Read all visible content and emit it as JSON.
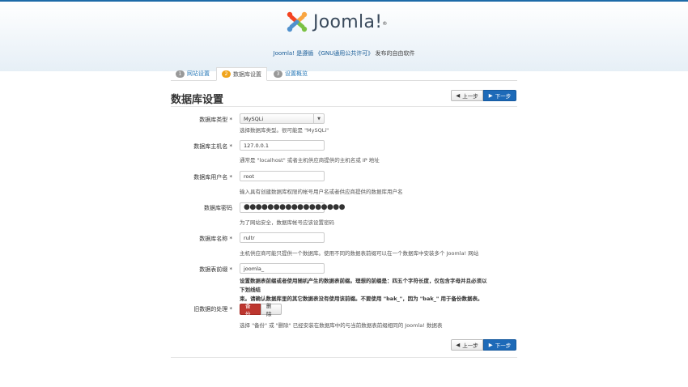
{
  "header": {
    "logo_text": "Joomla!",
    "tagline_prefix": "Joomla! 是遵循",
    "tagline_link": "《GNU通用公共许可》",
    "tagline_suffix": "发布的自由软件"
  },
  "tabs": [
    {
      "number": "1",
      "label": "网站设置",
      "active": false
    },
    {
      "number": "2",
      "label": "数据库设置",
      "active": true
    },
    {
      "number": "3",
      "label": "设置概览",
      "active": false
    }
  ],
  "page": {
    "title": "数据库设置",
    "prev_label": "上一步",
    "next_label": "下一步"
  },
  "form": {
    "db_type": {
      "label": "数据库类型",
      "value": "MySQLi",
      "help": "选择数据库类型。很可能是 \"MySQLi\""
    },
    "db_host": {
      "label": "数据库主机名",
      "value": "127.0.0.1",
      "help": "通常是 \"localhost\" 或者主机供应商提供的主机名或 IP 地址"
    },
    "db_user": {
      "label": "数据库用户名",
      "value": "root",
      "help": "输入具有创建数据库权限的帐号用户名或者供应商提供的数据库用户名"
    },
    "db_pass": {
      "label": "数据库密码",
      "value": "●●●●●●●●●●●●●●●●●",
      "help": "为了网站安全，数据库帐号应该设置密码"
    },
    "db_name": {
      "label": "数据库名称",
      "value": "rultr",
      "help": "主机供应商可能只提供一个数据库。使用不同的数据表前缀可以在一个数据库中安装多个 Joomla! 网站"
    },
    "db_prefix": {
      "label": "数据表前缀",
      "value": "joomla_",
      "help_line1": "设置数据表前缀或者使用随机产生的数据表前缀。理想的前缀是：四五个字符长度，仅包含字母并且必须以下划线结",
      "help_line2": "束。请确认数据库里的其它数据表没有使用该前缀。不要使用 \"bak_\"，因为 \"bak_\" 用于备份数据表。"
    },
    "old_db": {
      "label": "旧数据的处理",
      "option_on": "备份",
      "option_off": "删除",
      "help": "选择 \"备份\" 或 \"删除\" 已经安装在数据库中的与当前数据表前缀相同的 Joomla! 数据表"
    },
    "required_mark": "*"
  },
  "colors": {
    "primary": "#1d6ab8",
    "danger": "#bd362f",
    "badge_active": "#f0a41b",
    "link": "#2a7ab8"
  }
}
